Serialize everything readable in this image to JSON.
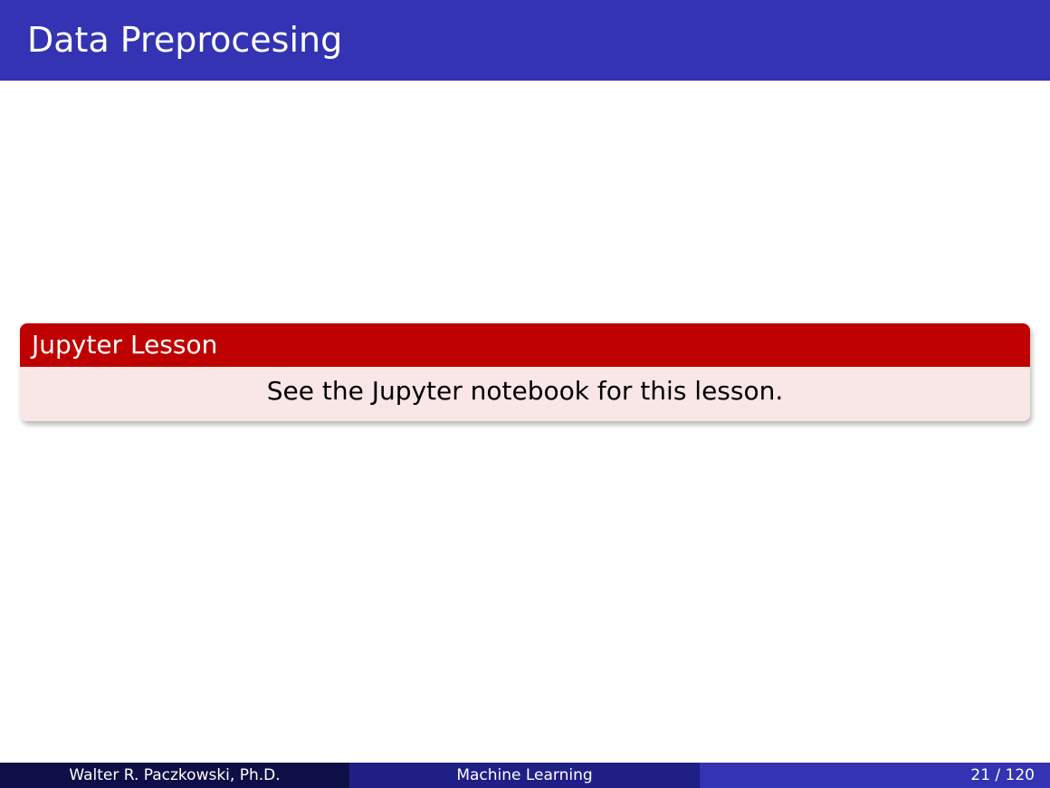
{
  "slide": {
    "title": "Data Preprocesing"
  },
  "block": {
    "title": "Jupyter Lesson",
    "body": "See the Jupyter notebook for this lesson."
  },
  "footer": {
    "author": "Walter R. Paczkowski, Ph.D.",
    "presentation_title": "Machine Learning",
    "page_number": "21 / 120"
  },
  "colors": {
    "title_bar": "#3333b3",
    "block_header": "#bf0000",
    "block_body": "#f9e6e6",
    "footer_left": "#0f0f47",
    "footer_middle": "#1f1f85",
    "footer_right": "#3333b3"
  }
}
